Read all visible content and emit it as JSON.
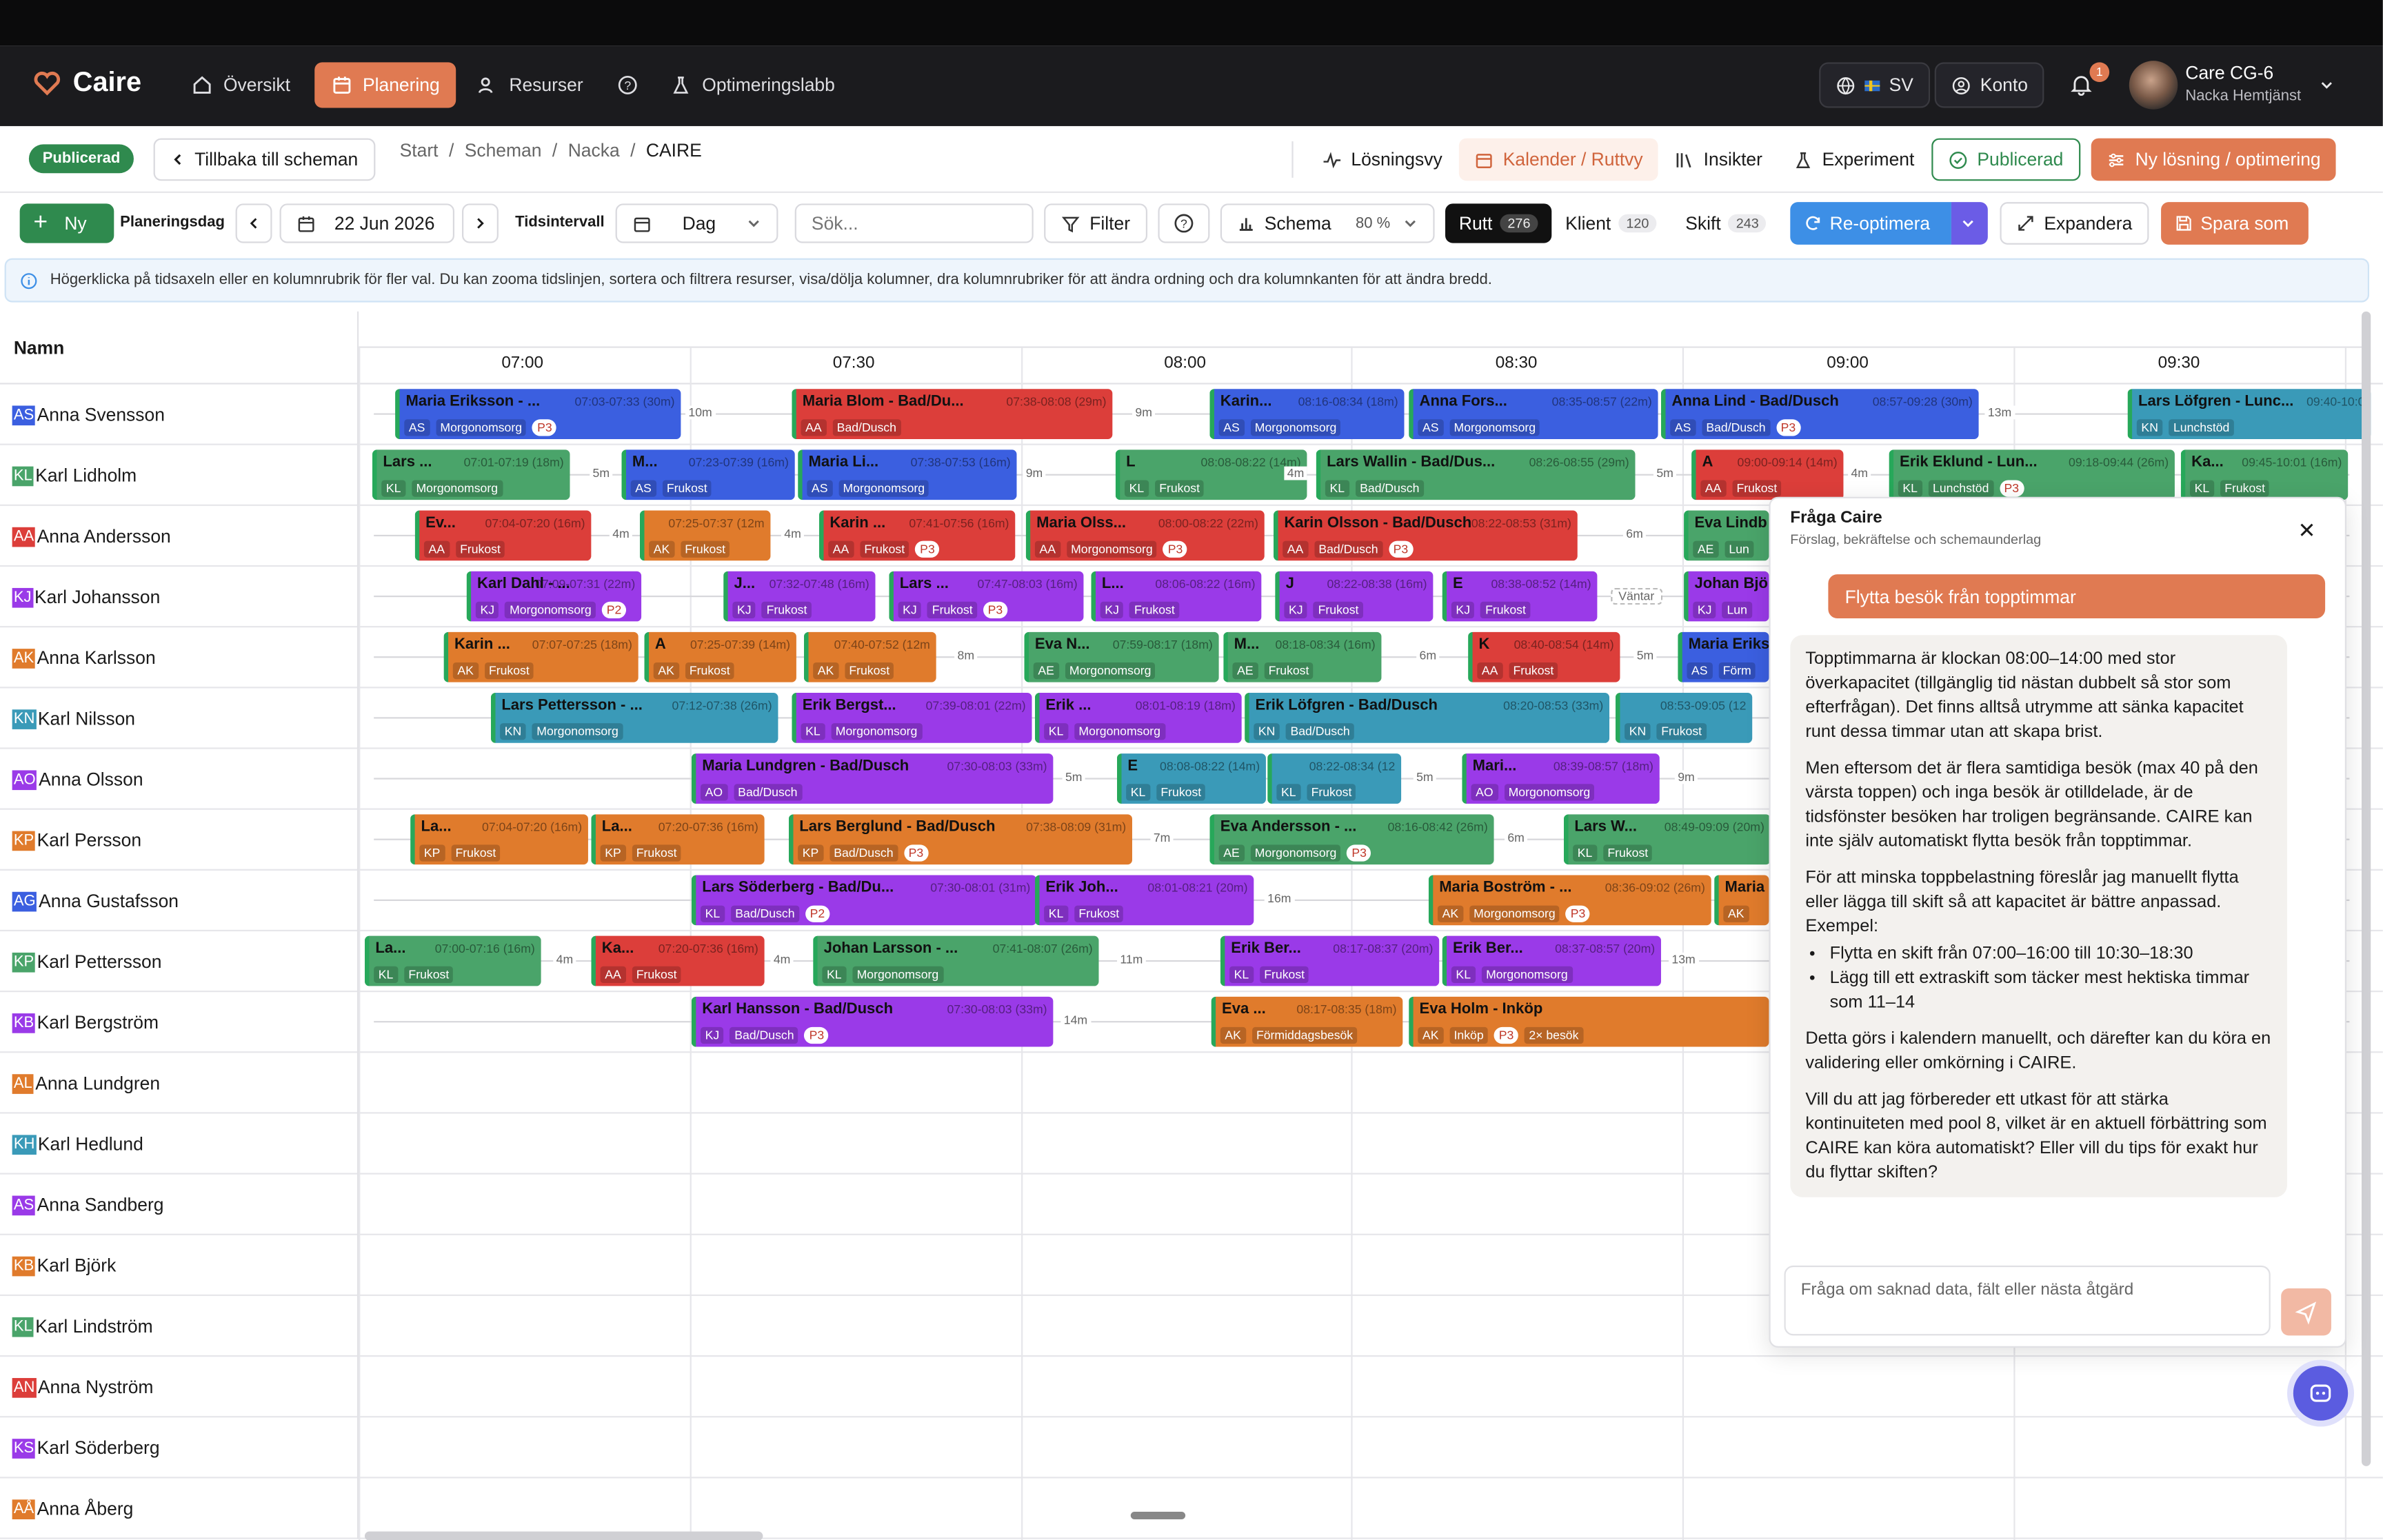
{
  "app": {
    "brand": "Caire"
  },
  "nav": {
    "items": [
      {
        "label": "Översikt",
        "icon": "home-icon"
      },
      {
        "label": "Planering",
        "icon": "calendar-icon",
        "active": true
      },
      {
        "label": "Resurser",
        "icon": "users-icon"
      },
      {
        "label": "",
        "icon": "help-icon"
      },
      {
        "label": "Optimeringslabb",
        "icon": "flask-icon"
      }
    ],
    "language": "SV",
    "account": "Konto",
    "notifications": "1",
    "user": {
      "name": "Care CG-6",
      "org": "Nacka Hemtjänst"
    }
  },
  "subbar": {
    "status": "Publicerad",
    "back": "Tillbaka till scheman",
    "breadcrumb": [
      "Start",
      "Scheman",
      "Nacka",
      "CAIRE"
    ],
    "actions": [
      "Lösningsvy",
      "Kalender / Ruttvy",
      "Insikter",
      "Experiment",
      "Publicerad",
      "Ny lösning / optimering"
    ]
  },
  "toolbar": {
    "new": "Ny",
    "planning_day_label": "Planeringsdag",
    "date": "22 Jun 2026",
    "interval_label": "Tidsintervall",
    "interval": "Dag",
    "search_placeholder": "Sök...",
    "filter": "Filter",
    "schema": "Schema",
    "schema_pct": "80 %",
    "views": [
      {
        "label": "Rutt",
        "count": "276",
        "active": true
      },
      {
        "label": "Klient",
        "count": "120"
      },
      {
        "label": "Skift",
        "count": "243"
      }
    ],
    "reoptimize": "Re-optimera",
    "expand": "Expandera",
    "save_as": "Spara som"
  },
  "info": "Högerklicka på tidsaxeln eller en kolumnrubrik för fler val. Du kan zooma tidslinjen, sortera och filtrera resurser, visa/dölja kolumner, dra kolumnrubriker för att ändra ordning och dra kolumnkanten för att ändra bredd.",
  "grid": {
    "name_header": "Namn",
    "times": [
      "07:00",
      "07:30",
      "08:00",
      "08:30",
      "09:00",
      "09:30"
    ]
  },
  "colors": {
    "blue": "#3b5fe0",
    "red": "#dc3e3a",
    "green": "#4aa46a",
    "purple": "#9a3ae8",
    "orange": "#e07b2c",
    "teal": "#3a9ab8",
    "brand": "#e07a52"
  },
  "rows": [
    {
      "ini": "AS",
      "name": "Anna Svensson",
      "color": "#3b5fe0"
    },
    {
      "ini": "KL",
      "name": "Karl Lidholm",
      "color": "#4aa46a"
    },
    {
      "ini": "AA",
      "name": "Anna Andersson",
      "color": "#dc3e3a"
    },
    {
      "ini": "KJ",
      "name": "Karl Johansson",
      "color": "#9a3ae8"
    },
    {
      "ini": "AK",
      "name": "Anna Karlsson",
      "color": "#e07b2c"
    },
    {
      "ini": "KN",
      "name": "Karl Nilsson",
      "color": "#3a9ab8"
    },
    {
      "ini": "AO",
      "name": "Anna Olsson",
      "color": "#9a3ae8"
    },
    {
      "ini": "KP",
      "name": "Karl Persson",
      "color": "#e07b2c"
    },
    {
      "ini": "AG",
      "name": "Anna Gustafsson",
      "color": "#3b5fe0"
    },
    {
      "ini": "KP",
      "name": "Karl Pettersson",
      "color": "#4aa46a"
    },
    {
      "ini": "KB",
      "name": "Karl Bergström",
      "color": "#9a3ae8"
    },
    {
      "ini": "AL",
      "name": "Anna Lundgren",
      "color": "#e07b2c"
    },
    {
      "ini": "KH",
      "name": "Karl Hedlund",
      "color": "#3a9ab8"
    },
    {
      "ini": "AS",
      "name": "Anna Sandberg",
      "color": "#9a3ae8"
    },
    {
      "ini": "KB",
      "name": "Karl Björk",
      "color": "#e07b2c"
    },
    {
      "ini": "KL",
      "name": "Karl Lindström",
      "color": "#4aa46a"
    },
    {
      "ini": "AN",
      "name": "Anna Nyström",
      "color": "#dc3e3a"
    },
    {
      "ini": "KS",
      "name": "Karl Söderberg",
      "color": "#9a3ae8"
    },
    {
      "ini": "AÅ",
      "name": "Anna Åberg",
      "color": "#e07b2c"
    }
  ],
  "visits": [
    {
      "row": 0,
      "c": "blue",
      "t": "Maria Eriksson - ...",
      "tm": "07:03-07:33 (30m)",
      "ini": "AS",
      "type": "Morgonomsorg",
      "p": "P3"
    },
    {
      "row": 0,
      "c": "red",
      "t": "Maria Blom - Bad/Du...",
      "tm": "07:38-08:08 (29m)",
      "ini": "AA",
      "type": "Bad/Dusch"
    },
    {
      "row": 0,
      "c": "blue",
      "t": "Karin...",
      "tm": "08:16-08:34 (18m)",
      "ini": "AS",
      "type": "Morgonomsorg"
    },
    {
      "row": 0,
      "c": "blue",
      "t": "Anna Fors...",
      "tm": "08:35-08:57 (22m)",
      "ini": "AS",
      "type": "Morgonomsorg"
    },
    {
      "row": 0,
      "c": "blue",
      "t": "Anna Lind - Bad/Dusch",
      "tm": "08:57-09:28 (30m)",
      "ini": "AS",
      "type": "Bad/Dusch",
      "p": "P3"
    },
    {
      "row": 0,
      "c": "teal",
      "t": "Lars Löfgren - Lunc...",
      "tm": "09:40-10:0",
      "ini": "KN",
      "type": "Lunchstöd"
    },
    {
      "row": 1,
      "c": "green",
      "t": "Lars ...",
      "tm": "07:01-07:19 (18m)",
      "ini": "KL",
      "type": "Morgonomsorg"
    },
    {
      "row": 1,
      "c": "blue",
      "t": "M...",
      "tm": "07:23-07:39 (16m)",
      "ini": "AS",
      "type": "Frukost"
    },
    {
      "row": 1,
      "c": "blue",
      "t": "Maria Li...",
      "tm": "07:38-07:53 (16m)",
      "ini": "AS",
      "type": "Morgonomsorg"
    },
    {
      "row": 1,
      "c": "green",
      "t": "L",
      "tm": "08:08-08:22 (14m)",
      "ini": "KL",
      "type": "Frukost"
    },
    {
      "row": 1,
      "c": "green",
      "t": "Lars Wallin - Bad/Dus...",
      "tm": "08:26-08:55 (29m)",
      "ini": "KL",
      "type": "Bad/Dusch"
    },
    {
      "row": 1,
      "c": "red",
      "t": "A",
      "tm": "09:00-09:14 (14m)",
      "ini": "AA",
      "type": "Frukost"
    },
    {
      "row": 1,
      "c": "green",
      "t": "Erik Eklund - Lun...",
      "tm": "09:18-09:44 (26m)",
      "ini": "KL",
      "type": "Lunchstöd",
      "p": "P3"
    },
    {
      "row": 1,
      "c": "green",
      "t": "Ka...",
      "tm": "09:45-10:01 (16m)",
      "ini": "KL",
      "type": "Frukost"
    },
    {
      "row": 2,
      "c": "red",
      "t": "Ev...",
      "tm": "07:04-07:20 (16m)",
      "ini": "AA",
      "type": "Frukost"
    },
    {
      "row": 2,
      "c": "orange",
      "t": "",
      "tm": "07:25-07:37 (12m",
      "ini": "AK",
      "type": "Frukost"
    },
    {
      "row": 2,
      "c": "red",
      "t": "Karin ...",
      "tm": "07:41-07:56 (16m)",
      "ini": "AA",
      "type": "Frukost",
      "p": "P3"
    },
    {
      "row": 2,
      "c": "red",
      "t": "Maria Olss...",
      "tm": "08:00-08:22 (22m)",
      "ini": "AA",
      "type": "Morgonomsorg",
      "p": "P3"
    },
    {
      "row": 2,
      "c": "red",
      "t": "Karin Olsson - Bad/Dusch",
      "tm": "08:22-08:53 (31m)",
      "ini": "AA",
      "type": "Bad/Dusch",
      "p": "P3"
    },
    {
      "row": 2,
      "c": "green",
      "t": "Eva Lindb",
      "tm": "",
      "ini": "AE",
      "type": "Lun"
    },
    {
      "row": 3,
      "c": "purple",
      "t": "Karl Dahl - ...",
      "tm": "07:09-07:31 (22m)",
      "ini": "KJ",
      "type": "Morgonomsorg",
      "p": "P2"
    },
    {
      "row": 3,
      "c": "purple",
      "t": "J...",
      "tm": "07:32-07:48 (16m)",
      "ini": "KJ",
      "type": "Frukost"
    },
    {
      "row": 3,
      "c": "purple",
      "t": "Lars ...",
      "tm": "07:47-08:03 (16m)",
      "ini": "KJ",
      "type": "Frukost",
      "p": "P3"
    },
    {
      "row": 3,
      "c": "purple",
      "t": "L...",
      "tm": "08:06-08:22 (16m)",
      "ini": "KJ",
      "type": "Frukost"
    },
    {
      "row": 3,
      "c": "purple",
      "t": "J",
      "tm": "08:22-08:38 (16m)",
      "ini": "KJ",
      "type": "Frukost"
    },
    {
      "row": 3,
      "c": "purple",
      "t": "E",
      "tm": "08:38-08:52 (14m)",
      "ini": "KJ",
      "type": "Frukost"
    },
    {
      "row": 3,
      "c": "purple",
      "t": "Johan Bjö",
      "tm": "",
      "ini": "KJ",
      "type": "Lun"
    },
    {
      "row": 4,
      "c": "orange",
      "t": "Karin ...",
      "tm": "07:07-07:25 (18m)",
      "ini": "AK",
      "type": "Frukost"
    },
    {
      "row": 4,
      "c": "orange",
      "t": "A",
      "tm": "07:25-07:39 (14m)",
      "ini": "AK",
      "type": "Frukost"
    },
    {
      "row": 4,
      "c": "orange",
      "t": "",
      "tm": "07:40-07:52 (12m",
      "ini": "AK",
      "type": "Frukost"
    },
    {
      "row": 4,
      "c": "green",
      "t": "Eva N...",
      "tm": "07:59-08:17 (18m)",
      "ini": "AE",
      "type": "Morgonomsorg"
    },
    {
      "row": 4,
      "c": "green",
      "t": "M...",
      "tm": "08:18-08:34 (16m)",
      "ini": "AE",
      "type": "Frukost"
    },
    {
      "row": 4,
      "c": "red",
      "t": "K",
      "tm": "08:40-08:54 (14m)",
      "ini": "AA",
      "type": "Frukost"
    },
    {
      "row": 4,
      "c": "blue",
      "t": "Maria Eriks",
      "tm": "",
      "ini": "AS",
      "type": "Förm"
    },
    {
      "row": 5,
      "c": "teal",
      "t": "Lars Pettersson - ...",
      "tm": "07:12-07:38 (26m)",
      "ini": "KN",
      "type": "Morgonomsorg"
    },
    {
      "row": 5,
      "c": "purple",
      "t": "Erik Bergst...",
      "tm": "07:39-08:01 (22m)",
      "ini": "KL",
      "type": "Morgonomsorg"
    },
    {
      "row": 5,
      "c": "purple",
      "t": "Erik ...",
      "tm": "08:01-08:19 (18m)",
      "ini": "KL",
      "type": "Morgonomsorg"
    },
    {
      "row": 5,
      "c": "teal",
      "t": "Erik Löfgren - Bad/Dusch",
      "tm": "08:20-08:53 (33m)",
      "ini": "KN",
      "type": "Bad/Dusch"
    },
    {
      "row": 5,
      "c": "teal",
      "t": "",
      "tm": "08:53-09:05 (12",
      "ini": "KN",
      "type": "Frukost"
    },
    {
      "row": 6,
      "c": "purple",
      "t": "Maria Lundgren - Bad/Dusch",
      "tm": "07:30-08:03 (33m)",
      "ini": "AO",
      "type": "Bad/Dusch"
    },
    {
      "row": 6,
      "c": "teal",
      "t": "E",
      "tm": "08:08-08:22 (14m)",
      "ini": "KL",
      "type": "Frukost"
    },
    {
      "row": 6,
      "c": "teal",
      "t": "",
      "tm": "08:22-08:34 (12",
      "ini": "KL",
      "type": "Frukost"
    },
    {
      "row": 6,
      "c": "purple",
      "t": "Mari...",
      "tm": "08:39-08:57 (18m)",
      "ini": "AO",
      "type": "Morgonomsorg"
    },
    {
      "row": 7,
      "c": "orange",
      "t": "La...",
      "tm": "07:04-07:20 (16m)",
      "ini": "KP",
      "type": "Frukost"
    },
    {
      "row": 7,
      "c": "orange",
      "t": "La...",
      "tm": "07:20-07:36 (16m)",
      "ini": "KP",
      "type": "Frukost"
    },
    {
      "row": 7,
      "c": "orange",
      "t": "Lars Berglund - Bad/Dusch",
      "tm": "07:38-08:09 (31m)",
      "ini": "KP",
      "type": "Bad/Dusch",
      "p": "P3"
    },
    {
      "row": 7,
      "c": "green",
      "t": "Eva Andersson - ...",
      "tm": "08:16-08:42 (26m)",
      "ini": "AE",
      "type": "Morgonomsorg",
      "p": "P3"
    },
    {
      "row": 7,
      "c": "green",
      "t": "Lars W...",
      "tm": "08:49-09:09 (20m)",
      "ini": "KL",
      "type": "Frukost"
    },
    {
      "row": 8,
      "c": "purple",
      "t": "Lars Söderberg - Bad/Du...",
      "tm": "07:30-08:01 (31m)",
      "ini": "KL",
      "type": "Bad/Dusch",
      "p": "P2"
    },
    {
      "row": 8,
      "c": "purple",
      "t": "Erik Joh...",
      "tm": "08:01-08:21 (20m)",
      "ini": "KL",
      "type": "Frukost"
    },
    {
      "row": 8,
      "c": "orange",
      "t": "Maria Boström - ...",
      "tm": "08:36-09:02 (26m)",
      "ini": "AK",
      "type": "Morgonomsorg",
      "p": "P3"
    },
    {
      "row": 8,
      "c": "orange",
      "t": "Maria",
      "tm": "",
      "ini": "AK",
      "type": ""
    },
    {
      "row": 9,
      "c": "green",
      "t": "La...",
      "tm": "07:00-07:16 (16m)",
      "ini": "KL",
      "type": "Frukost"
    },
    {
      "row": 9,
      "c": "red",
      "t": "Ka...",
      "tm": "07:20-07:36 (16m)",
      "ini": "AA",
      "type": "Frukost"
    },
    {
      "row": 9,
      "c": "green",
      "t": "Johan Larsson - ...",
      "tm": "07:41-08:07 (26m)",
      "ini": "KL",
      "type": "Morgonomsorg"
    },
    {
      "row": 9,
      "c": "purple",
      "t": "Erik Ber...",
      "tm": "08:17-08:37 (20m)",
      "ini": "KL",
      "type": "Frukost"
    },
    {
      "row": 9,
      "c": "purple",
      "t": "Erik Ber...",
      "tm": "08:37-08:57 (20m)",
      "ini": "KL",
      "type": "Morgonomsorg"
    },
    {
      "row": 10,
      "c": "purple",
      "t": "Karl Hansson - Bad/Dusch",
      "tm": "07:30-08:03 (33m)",
      "ini": "KJ",
      "type": "Bad/Dusch",
      "p": "P3"
    },
    {
      "row": 10,
      "c": "orange",
      "t": "Eva ...",
      "tm": "08:17-08:35 (18m)",
      "ini": "AK",
      "type": "Förmiddagsbesök"
    },
    {
      "row": 10,
      "c": "orange",
      "t": "Eva Holm - Inköp",
      "tm": "",
      "ini": "AK",
      "type": "Inköp",
      "p": "P3",
      "extra": "2× besök"
    }
  ],
  "gaps": [
    {
      "row": 0,
      "t": "10m"
    },
    {
      "row": 0,
      "t": "9m"
    },
    {
      "row": 0,
      "t": "13m"
    },
    {
      "row": 1,
      "t": "5m"
    },
    {
      "row": 1,
      "t": "9m"
    },
    {
      "row": 1,
      "t": "4m"
    },
    {
      "row": 1,
      "t": "5m"
    },
    {
      "row": 1,
      "t": "4m"
    },
    {
      "row": 2,
      "t": "4m"
    },
    {
      "row": 2,
      "t": "4m"
    },
    {
      "row": 2,
      "t": "6m"
    },
    {
      "row": 3,
      "t": "Väntar"
    },
    {
      "row": 4,
      "t": "8m"
    },
    {
      "row": 4,
      "t": "6m"
    },
    {
      "row": 4,
      "t": "5m"
    },
    {
      "row": 6,
      "t": "5m"
    },
    {
      "row": 6,
      "t": "5m"
    },
    {
      "row": 6,
      "t": "9m"
    },
    {
      "row": 7,
      "t": "7m"
    },
    {
      "row": 7,
      "t": "6m"
    },
    {
      "row": 8,
      "t": "16m"
    },
    {
      "row": 9,
      "t": "4m"
    },
    {
      "row": 9,
      "t": "4m"
    },
    {
      "row": 9,
      "t": "11m"
    },
    {
      "row": 9,
      "t": "13m"
    },
    {
      "row": 10,
      "t": "14m"
    }
  ],
  "assistant": {
    "title": "Fråga Caire",
    "subtitle": "Förslag, bekräftelse och schemaunderlag",
    "user_msg": "Flytta besök från topptimmar",
    "reply": [
      "Topptimmarna är klockan 08:00–14:00 med stor överkapacitet (tillgänglig tid nästan dubbelt så stor som efterfrågan). Det finns alltså utrymme att sänka kapacitet runt dessa timmar utan att skapa brist.",
      "Men eftersom det är flera samtidiga besök (max 40 på den värsta toppen) och inga besök är otilldelade, är de tidsfönster besöken har troligen begränsande. CAIRE kan inte själv automatiskt flytta besök från topptimmar.",
      "För att minska toppbelastning föreslår jag manuellt flytta eller lägga till skift så att kapacitet är bättre anpassad. Exempel:"
    ],
    "bullets": [
      "Flytta en skift från 07:00–16:00 till 10:30–18:30",
      "Lägg till ett extraskift som täcker mest hektiska timmar som 11–14"
    ],
    "reply2": [
      "Detta görs i kalendern manuellt, och därefter kan du köra en validering eller omkörning i CAIRE.",
      "Vill du att jag förbereder ett utkast för att stärka kontinuiteten med pool 8, vilket är en aktuell förbättring som CAIRE kan köra automatiskt? Eller vill du tips för exakt hur du flyttar skiften?"
    ],
    "input_placeholder": "Fråga om saknad data, fält eller nästa åtgärd"
  }
}
